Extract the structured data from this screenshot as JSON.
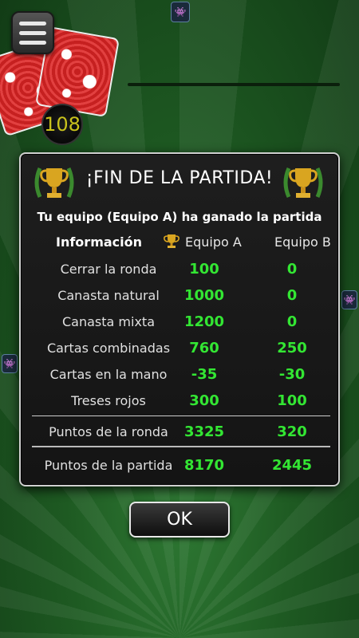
{
  "hud": {
    "deck_count": "108"
  },
  "dialog": {
    "title": "¡FIN DE LA PARTIDA!",
    "subtitle": "Tu equipo (Equipo A) ha ganado la partida",
    "headers": {
      "info": "Información",
      "team_a": "Equipo A",
      "team_b": "Equipo B"
    },
    "rows": [
      {
        "label": "Cerrar la ronda",
        "a": "100",
        "b": "0"
      },
      {
        "label": "Canasta natural",
        "a": "1000",
        "b": "0"
      },
      {
        "label": "Canasta mixta",
        "a": "1200",
        "b": "0"
      },
      {
        "label": "Cartas combinadas",
        "a": "760",
        "b": "250"
      },
      {
        "label": "Cartas en la mano",
        "a": "-35",
        "b": "-30"
      },
      {
        "label": "Treses rojos",
        "a": "300",
        "b": "100"
      }
    ],
    "round_points": {
      "label": "Puntos de la ronda",
      "a": "3325",
      "b": "320"
    },
    "game_points": {
      "label": "Puntos de la partida",
      "a": "8170",
      "b": "2445"
    },
    "ok_label": "OK"
  },
  "colors": {
    "value_green": "#33e633",
    "table_felt": "#1e5a22",
    "dialog_bg": "#181818",
    "deck_count": "#c9c21c"
  },
  "icons": [
    "menu-icon",
    "trophy-icon",
    "space-invader-icon"
  ]
}
